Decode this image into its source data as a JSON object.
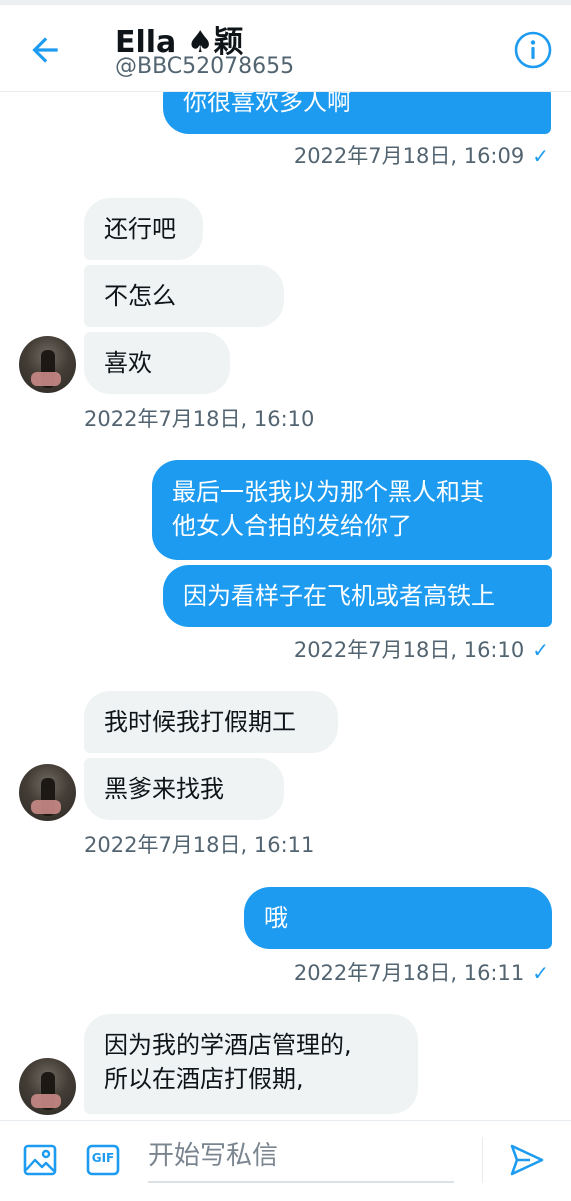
{
  "header": {
    "name": "Ella ♠颖",
    "handle": "@BBC52078655",
    "back_icon": "back-arrow-icon",
    "info_icon": "info-icon"
  },
  "colors": {
    "accent": "#1d9bf0",
    "incoming_bubble": "#eff3f4",
    "muted_text": "#536471"
  },
  "messages": [
    {
      "dir": "out",
      "text": "你很喜欢多人啊"
    },
    {
      "dir": "out-time",
      "text": "2022年7月18日, 16:09",
      "check": "✓"
    },
    {
      "dir": "in",
      "text": "还行吧"
    },
    {
      "dir": "in",
      "text": "不怎么"
    },
    {
      "dir": "in",
      "text": "喜欢"
    },
    {
      "dir": "in-time",
      "text": "2022年7月18日, 16:10"
    },
    {
      "dir": "out",
      "text_line1": "最后一张我以为那个黑人和其",
      "text_line2": "他女人合拍的发给你了"
    },
    {
      "dir": "out",
      "text": "因为看样子在飞机或者高铁上"
    },
    {
      "dir": "out-time",
      "text": "2022年7月18日, 16:10",
      "check": "✓"
    },
    {
      "dir": "in",
      "text": "我时候我打假期工"
    },
    {
      "dir": "in",
      "text": "黑爹来找我"
    },
    {
      "dir": "in-time",
      "text": "2022年7月18日, 16:11"
    },
    {
      "dir": "out",
      "text": "哦"
    },
    {
      "dir": "out-time",
      "text": "2022年7月18日, 16:11",
      "check": "✓"
    },
    {
      "dir": "in",
      "text_line1": "因为我的学酒店管理的,",
      "text_line2": "所以在酒店打假期,"
    }
  ],
  "composer": {
    "placeholder": "开始写私信",
    "image_icon": "image-icon",
    "gif_label": "GIF",
    "send_icon": "send-icon"
  }
}
